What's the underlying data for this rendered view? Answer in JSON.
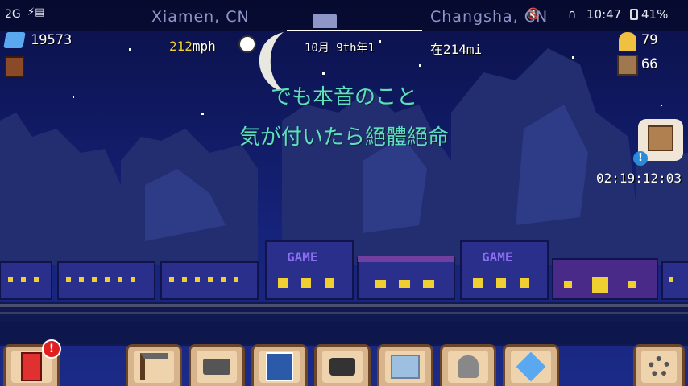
{
  "status_bar": {
    "left_text": "2G",
    "time": "10:47",
    "battery": "41%"
  },
  "route": {
    "origin": "Xiamen, CN",
    "destination": "Changsha, CN",
    "speed_value": "212",
    "speed_unit": "mph",
    "date": "10月 9th年1",
    "distance": "在214mi"
  },
  "resources": {
    "gems": "19573",
    "passengers": "79",
    "cargo": "66"
  },
  "lyrics": {
    "line1": "でも本音のこと",
    "line2": "気が付いたら絕體絕命"
  },
  "delivery": {
    "timer": "02:19:12:03",
    "alert": "!"
  },
  "train": {
    "car_sign_1": "GAME",
    "car_sign_2": "GAME"
  },
  "toolbar": {
    "items": [
      "shop",
      "build",
      "trains",
      "blueprints",
      "photo",
      "map",
      "passengers",
      "gems",
      "settings"
    ],
    "shop_alert": "!"
  },
  "colors": {
    "sky": "#0c1452",
    "lyric": "#5ee0c0",
    "toolbar_button": "#d8b48c",
    "toolbar_border": "#6a4528"
  }
}
